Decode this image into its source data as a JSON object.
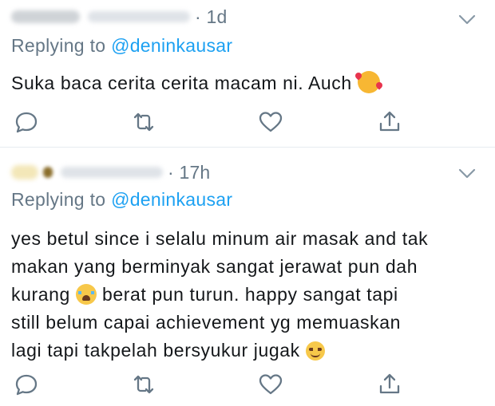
{
  "tweets": [
    {
      "time": "· 1d",
      "replying_prefix": "Replying to ",
      "replying_handle": "@deninkausar",
      "text_lines": [
        "Suka baca cerita cerita macam ni.  Auch"
      ],
      "emojis": [
        "smiling-face-with-hearts"
      ]
    },
    {
      "time": "· 17h",
      "replying_prefix": "Replying to ",
      "replying_handle": "@deninkausar",
      "text_lines": [
        "yes betul since i selalu minum air masak and tak",
        "makan yang berminyak sangat jerawat pun dah",
        "kurang",
        "berat pun turun. happy sangat tapi",
        "still belum capai achievement yg memuaskan",
        "lagi tapi takpelah bersyukur jugak"
      ],
      "emojis": [
        "loudly-crying-face",
        "relieved-face"
      ]
    }
  ],
  "icons": {
    "reply": "reply-icon",
    "retweet": "retweet-icon",
    "like": "heart-icon",
    "share": "share-icon",
    "more": "chevron-down-icon"
  },
  "colors": {
    "text": "#14171a",
    "secondary": "#657786",
    "link": "#1da1f2",
    "divider": "#e6ecf0"
  }
}
